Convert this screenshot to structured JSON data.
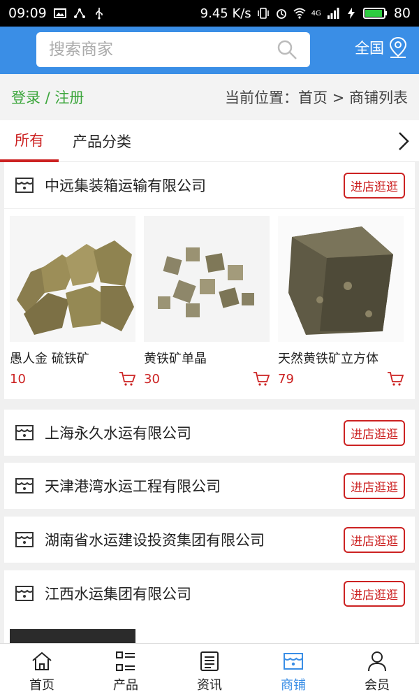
{
  "status_bar": {
    "time": "09:09",
    "speed": "9.45 K/s",
    "signal_label": "4G",
    "battery": "80"
  },
  "header": {
    "search_placeholder": "搜索商家",
    "region_label": "全国"
  },
  "crumb": {
    "login": "登录 / 注册",
    "location": "当前位置：首页 > 商铺列表"
  },
  "tabs": {
    "all": "所有",
    "category": "产品分类"
  },
  "shops": [
    {
      "name": "中远集装箱运输有限公司",
      "button": "进店逛逛",
      "products": [
        {
          "name": "愚人金 硫铁矿",
          "price": "10"
        },
        {
          "name": "黄铁矿单晶",
          "price": "30"
        },
        {
          "name": "天然黄铁矿立方体",
          "price": "79"
        }
      ]
    },
    {
      "name": "上海永久水运有限公司",
      "button": "进店逛逛"
    },
    {
      "name": "天津港湾水运工程有限公司",
      "button": "进店逛逛"
    },
    {
      "name": "湖南省水运建设投资集团有限公司",
      "button": "进店逛逛"
    },
    {
      "name": "江西水运集团有限公司",
      "button": "进店逛逛"
    }
  ],
  "nav": [
    {
      "label": "首页",
      "icon": "home-icon"
    },
    {
      "label": "产品",
      "icon": "grid-list-icon"
    },
    {
      "label": "资讯",
      "icon": "news-icon"
    },
    {
      "label": "商铺",
      "icon": "shop-icon"
    },
    {
      "label": "会员",
      "icon": "person-icon"
    }
  ],
  "colors": {
    "accent": "#3a8ee6",
    "red": "#cc2222",
    "green": "#3aa53a"
  }
}
